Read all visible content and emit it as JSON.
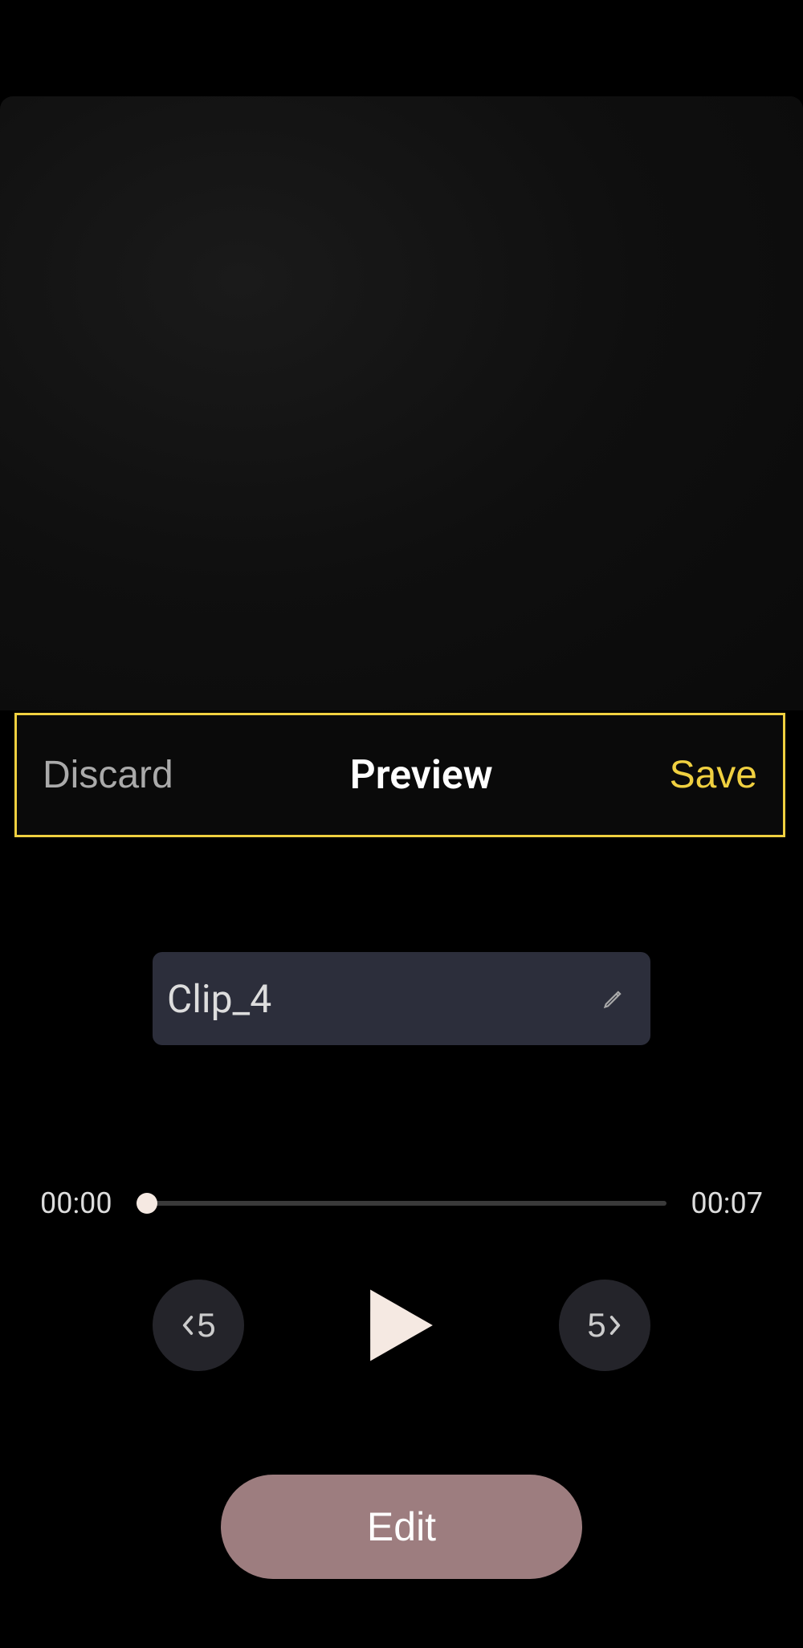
{
  "actions": {
    "discard": "Discard",
    "preview": "Preview",
    "save": "Save"
  },
  "clip": {
    "name": "Clip_4"
  },
  "player": {
    "current_time": "00:00",
    "total_time": "00:07",
    "skip_back_seconds": "5",
    "skip_forward_seconds": "5"
  },
  "edit_button": "Edit"
}
